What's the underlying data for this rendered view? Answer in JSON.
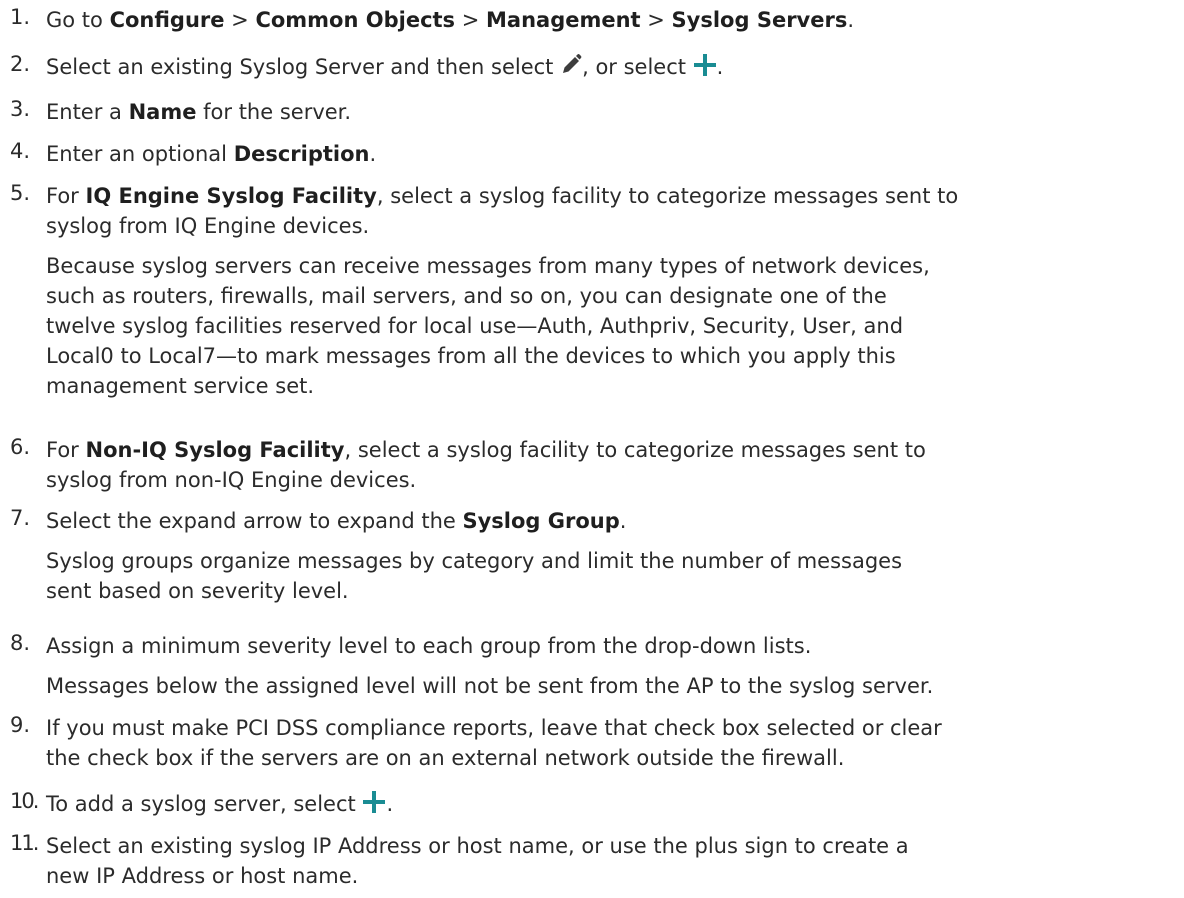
{
  "steps": [
    {
      "number": "1.",
      "prefix": "Go to ",
      "path": [
        "Configure",
        "Common Objects",
        "Management",
        "Syslog Servers"
      ],
      "separator": " > ",
      "suffix": "."
    },
    {
      "number": "2.",
      "part1": "Select an existing Syslog Server and then select ",
      "part2": ", or select ",
      "part3": ".",
      "icon1": "pencil-edit-icon",
      "icon2": "plus-add-icon"
    },
    {
      "number": "3.",
      "before": "Enter a ",
      "bold": "Name",
      "after": " for the server."
    },
    {
      "number": "4.",
      "before": "Enter an optional ",
      "bold": "Description",
      "after": "."
    },
    {
      "number": "5.",
      "before": "For ",
      "bold": "IQ Engine Syslog Facility",
      "after_line1": ", select a syslog facility to categorize messages sent to",
      "line2": "syslog from IQ Engine devices.",
      "note_lines": [
        "Because syslog servers can receive messages from many types of network devices,",
        "such as routers, firewalls, mail servers, and so on, you can designate one of the",
        "twelve syslog facilities reserved for local use—Auth, Authpriv, Security, User, and",
        "Local0 to Local7—to mark messages from all the devices to which you apply this",
        "management service set."
      ]
    },
    {
      "number": "6.",
      "before": "For ",
      "bold": "Non-IQ Syslog Facility",
      "after_line1": ", select a syslog facility to categorize messages sent to",
      "line2": "syslog from non-IQ Engine devices."
    },
    {
      "number": "7.",
      "before": "Select the expand arrow to expand the ",
      "bold": "Syslog Group",
      "after": ".",
      "note_lines": [
        "Syslog groups organize messages by category and limit the number of messages",
        "sent based on severity level."
      ]
    },
    {
      "number": "8.",
      "text": "Assign a minimum severity level to each group from the drop-down lists.",
      "note_lines": [
        "Messages below the assigned level will not be sent from the AP to the syslog server."
      ]
    },
    {
      "number": "9.",
      "line1": "If you must make PCI DSS compliance reports, leave that check box selected or clear",
      "line2": "the check box if the servers are on an external network outside the firewall."
    },
    {
      "number": "10.",
      "before": "To add a syslog server, select ",
      "after": ".",
      "icon": "plus-add-icon"
    },
    {
      "number": "11.",
      "line1": "Select an existing syslog IP Address or host name, or use the plus sign to create a",
      "line2": "new IP Address or host name."
    }
  ],
  "colors": {
    "text": "#2b2b2b",
    "bold_text": "#1f1f1f",
    "pencil_icon": "#3d3d3d",
    "plus_icon": "#1a8c93"
  }
}
